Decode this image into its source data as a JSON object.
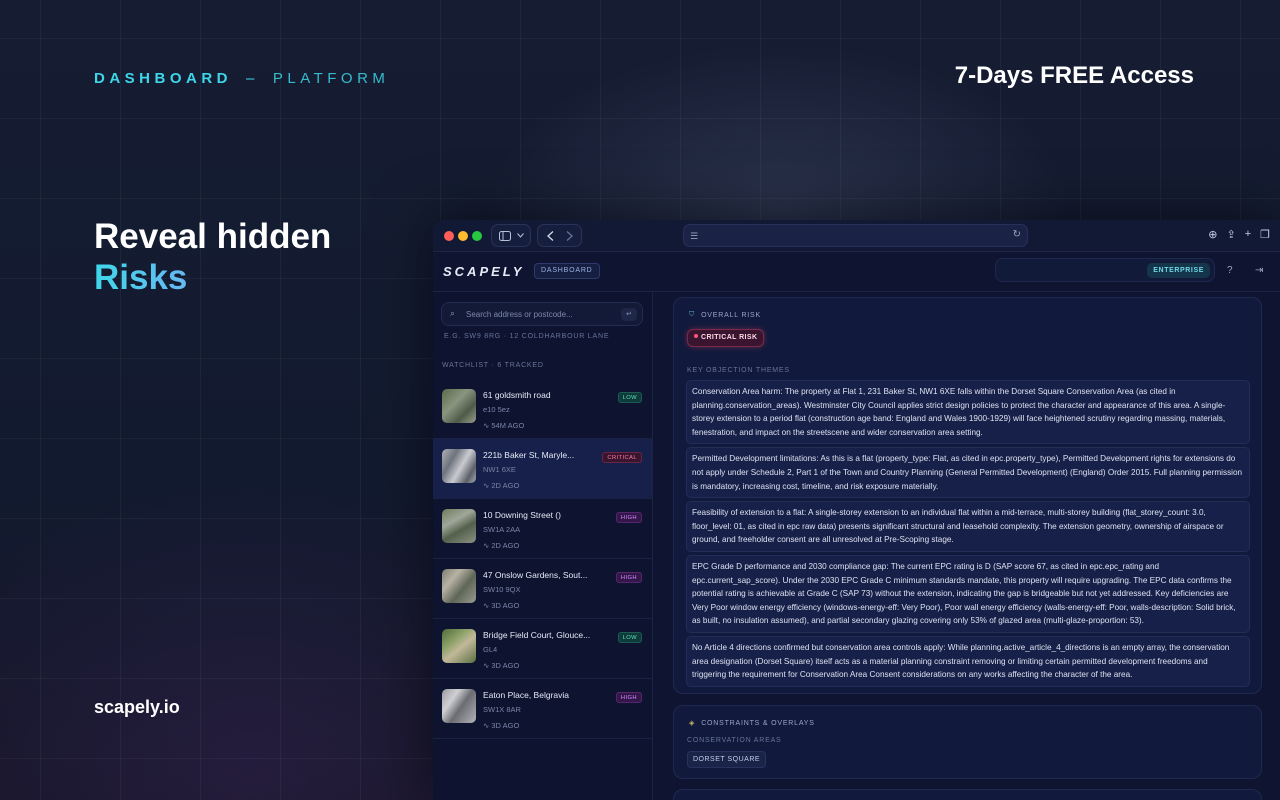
{
  "banner": {
    "dashboard": "DASHBOARD",
    "separator": "–",
    "platform": "PLATFORM",
    "offer": "7-Days FREE Access",
    "hero_line1": "Reveal hidden",
    "hero_line2": "Risks",
    "site": "scapely.io"
  },
  "app": {
    "logo": "SCAPELY",
    "nav_pill": "DASHBOARD",
    "plan": "ENTERPRISE"
  },
  "sidebar": {
    "search_placeholder": "Search address or postcode...",
    "hint": "E.G. SW9 8RG · 12 COLDHARBOUR LANE",
    "watchlist_title": "WATCHLIST · 6 TRACKED",
    "items": [
      {
        "name": "61 goldsmith road",
        "postcode": "e10 5ez",
        "ago": "54M AGO",
        "risk": "LOW",
        "level": "low"
      },
      {
        "name": "221b Baker St, Maryle...",
        "postcode": "NW1 6XE",
        "ago": "2D AGO",
        "risk": "CRITICAL",
        "level": "critical"
      },
      {
        "name": "10 Downing Street ()",
        "postcode": "SW1A 2AA",
        "ago": "2D AGO",
        "risk": "HIGH",
        "level": "high"
      },
      {
        "name": "47 Onslow Gardens, Sout...",
        "postcode": "SW10 9QX",
        "ago": "3D AGO",
        "risk": "HIGH",
        "level": "high"
      },
      {
        "name": "Bridge Field Court, Glouce...",
        "postcode": "GL4",
        "ago": "3D AGO",
        "risk": "LOW",
        "level": "low"
      },
      {
        "name": "Eaton Place, Belgravia",
        "postcode": "SW1X 8AR",
        "ago": "3D AGO",
        "risk": "HIGH",
        "level": "high"
      }
    ]
  },
  "overall": {
    "title": "OVERALL RISK",
    "risk": "CRITICAL RISK",
    "themes_title": "KEY OBJECTION THEMES",
    "themes": [
      "Conservation Area harm: The property at Flat 1, 231 Baker St, NW1 6XE falls within the Dorset Square Conservation Area (as cited in planning.conservation_areas). Westminster City Council applies strict design policies to protect the character and appearance of this area. A single-storey extension to a period flat (construction age band: England and Wales 1900-1929) will face heightened scrutiny regarding massing, materials, fenestration, and impact on the streetscene and wider conservation area setting.",
      "Permitted Development limitations: As this is a flat (property_type: Flat, as cited in epc.property_type), Permitted Development rights for extensions do not apply under Schedule 2, Part 1 of the Town and Country Planning (General Permitted Development) (England) Order 2015. Full planning permission is mandatory, increasing cost, timeline, and risk exposure materially.",
      "Feasibility of extension to a flat: A single-storey extension to an individual flat within a mid-terrace, multi-storey building (flat_storey_count: 3.0, floor_level: 01, as cited in epc raw data) presents significant structural and leasehold complexity. The extension geometry, ownership of airspace or ground, and freeholder consent are all unresolved at Pre-Scoping stage.",
      "EPC Grade D performance and 2030 compliance gap: The current EPC rating is D (SAP score 67, as cited in epc.epc_rating and epc.current_sap_score). Under the 2030 EPC Grade C minimum standards mandate, this property will require upgrading. The EPC data confirms the potential rating is achievable at Grade C (SAP 73) without the extension, indicating the gap is bridgeable but not yet addressed. Key deficiencies are Very Poor window energy efficiency (windows-energy-eff: Very Poor), Poor wall energy efficiency (walls-energy-eff: Poor, walls-description: Solid brick, as built, no insulation assumed), and partial secondary glazing covering only 53% of glazed area (multi-glaze-proportion: 53).",
      "No Article 4 directions confirmed but conservation area controls apply: While planning.active_article_4_directions is an empty array, the conservation area designation (Dorset Square) itself acts as a material planning constraint removing or limiting certain permitted development freedoms and triggering the requirement for Conservation Area Consent considerations on any works affecting the character of the area."
    ]
  },
  "constraints": {
    "title": "CONSTRAINTS & OVERLAYS",
    "subtitle": "CONSERVATION AREAS",
    "chip": "DORSET SQUARE"
  },
  "colors": {
    "accent_cyan": "#3ed6e8",
    "critical": "#ff5577",
    "low": "#5fe0c0",
    "high": "#d38cff"
  }
}
